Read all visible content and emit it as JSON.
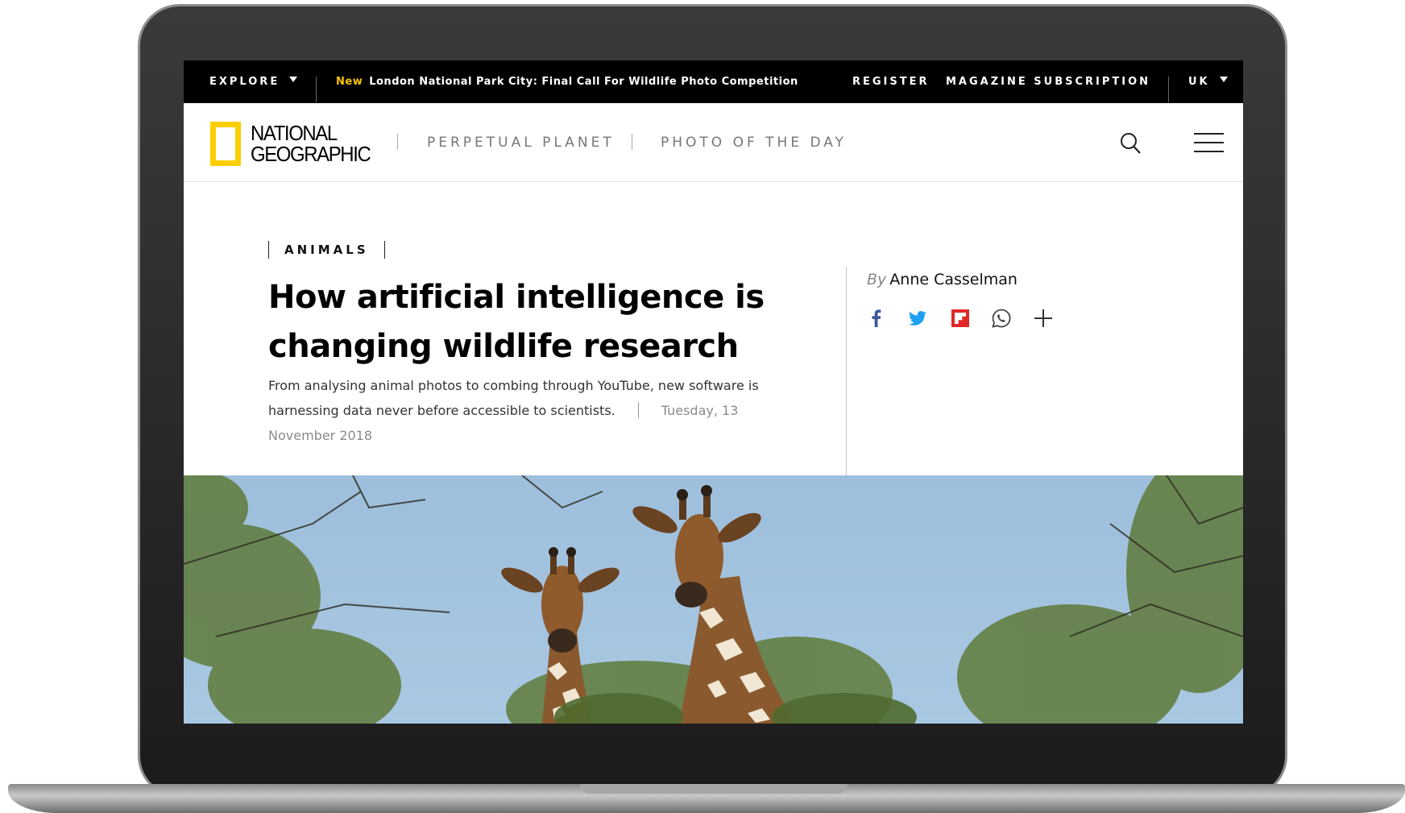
{
  "topbar": {
    "explore": "EXPLORE",
    "promo_tag": "New",
    "promo_text": "London National Park City: Final Call For Wildlife Photo Competition",
    "register": "REGISTER",
    "subscription": "MAGAZINE SUBSCRIPTION",
    "region": "UK"
  },
  "brand": {
    "line1": "NATIONAL",
    "line2": "GEOGRAPHIC",
    "color": "#ffce00"
  },
  "nav": {
    "links": [
      "PERPETUAL PLANET",
      "PHOTO OF THE DAY"
    ]
  },
  "article": {
    "kicker": "ANIMALS",
    "headline": "How artificial intelligence is changing wildlife research",
    "dek": "From analysing animal photos to combing through YouTube, new software is harnessing data never before accessible to scientists.",
    "date": "Tuesday, 13 November 2018",
    "by_prefix": "By",
    "author": "Anne Casselman"
  },
  "social": {
    "icons": [
      "facebook-icon",
      "twitter-icon",
      "flipboard-icon",
      "whatsapp-icon",
      "more-icon"
    ],
    "colors": {
      "facebook": "#3b5998",
      "twitter": "#1da1f2",
      "flipboard": "#e12828",
      "whatsapp": "#444444"
    }
  },
  "hero": {
    "subject": "giraffes-photo",
    "sky_color": "#9dbfdc"
  }
}
